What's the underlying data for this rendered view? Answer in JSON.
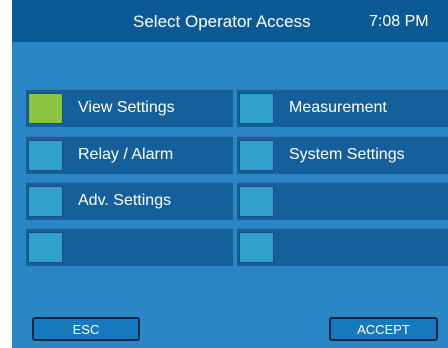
{
  "header": {
    "title": "Select Operator Access",
    "time": "7:08 PM"
  },
  "options": [
    {
      "label": "View Settings",
      "selected": true
    },
    {
      "label": "Measurement",
      "selected": false
    },
    {
      "label": "Relay / Alarm",
      "selected": false
    },
    {
      "label": "System Settings",
      "selected": false
    },
    {
      "label": "Adv. Settings",
      "selected": false
    },
    {
      "label": "",
      "selected": false
    },
    {
      "label": "",
      "selected": false
    },
    {
      "label": "",
      "selected": false
    }
  ],
  "buttons": {
    "esc": "ESC",
    "accept": "ACCEPT"
  },
  "colors": {
    "background": "#2b86c5",
    "header": "#0b5a95",
    "option_row": "#15609a",
    "swatch": "#2fa1cc",
    "swatch_selected": "#8bc540"
  }
}
